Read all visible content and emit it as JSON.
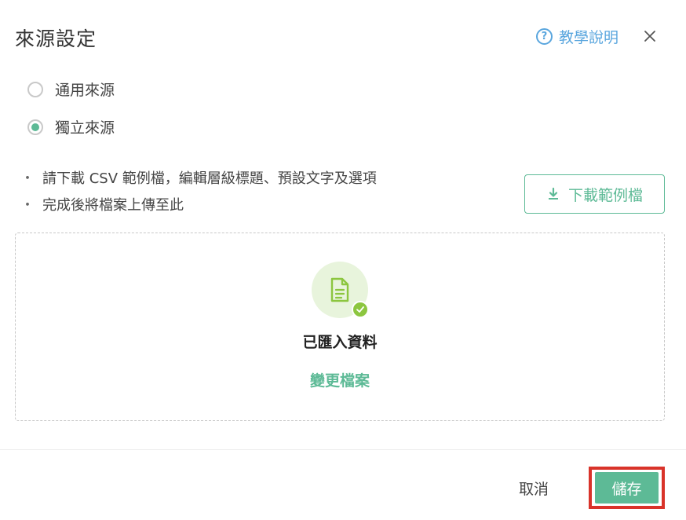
{
  "dialog": {
    "title": "來源設定",
    "help_label": "教學說明",
    "help_icon_glyph": "?"
  },
  "source_options": [
    {
      "label": "通用來源",
      "selected": false
    },
    {
      "label": "獨立來源",
      "selected": true
    }
  ],
  "instructions": [
    {
      "bullet": "・",
      "text": "請下載 CSV 範例檔，編輯層級標題、預設文字及選項"
    },
    {
      "bullet": "・",
      "text": "完成後將檔案上傳至此"
    }
  ],
  "download_button": {
    "label": "下載範例檔",
    "icon": "download-icon"
  },
  "upload": {
    "status_text": "已匯入資料",
    "change_label": "變更檔案",
    "icon": "file-icon",
    "status_icon": "check-icon"
  },
  "footer": {
    "cancel_label": "取消",
    "save_label": "儲存"
  },
  "colors": {
    "accent_green": "#5dba96",
    "help_blue": "#5aa6de",
    "check_green": "#8cc63f",
    "highlight_red": "#d9332a"
  }
}
